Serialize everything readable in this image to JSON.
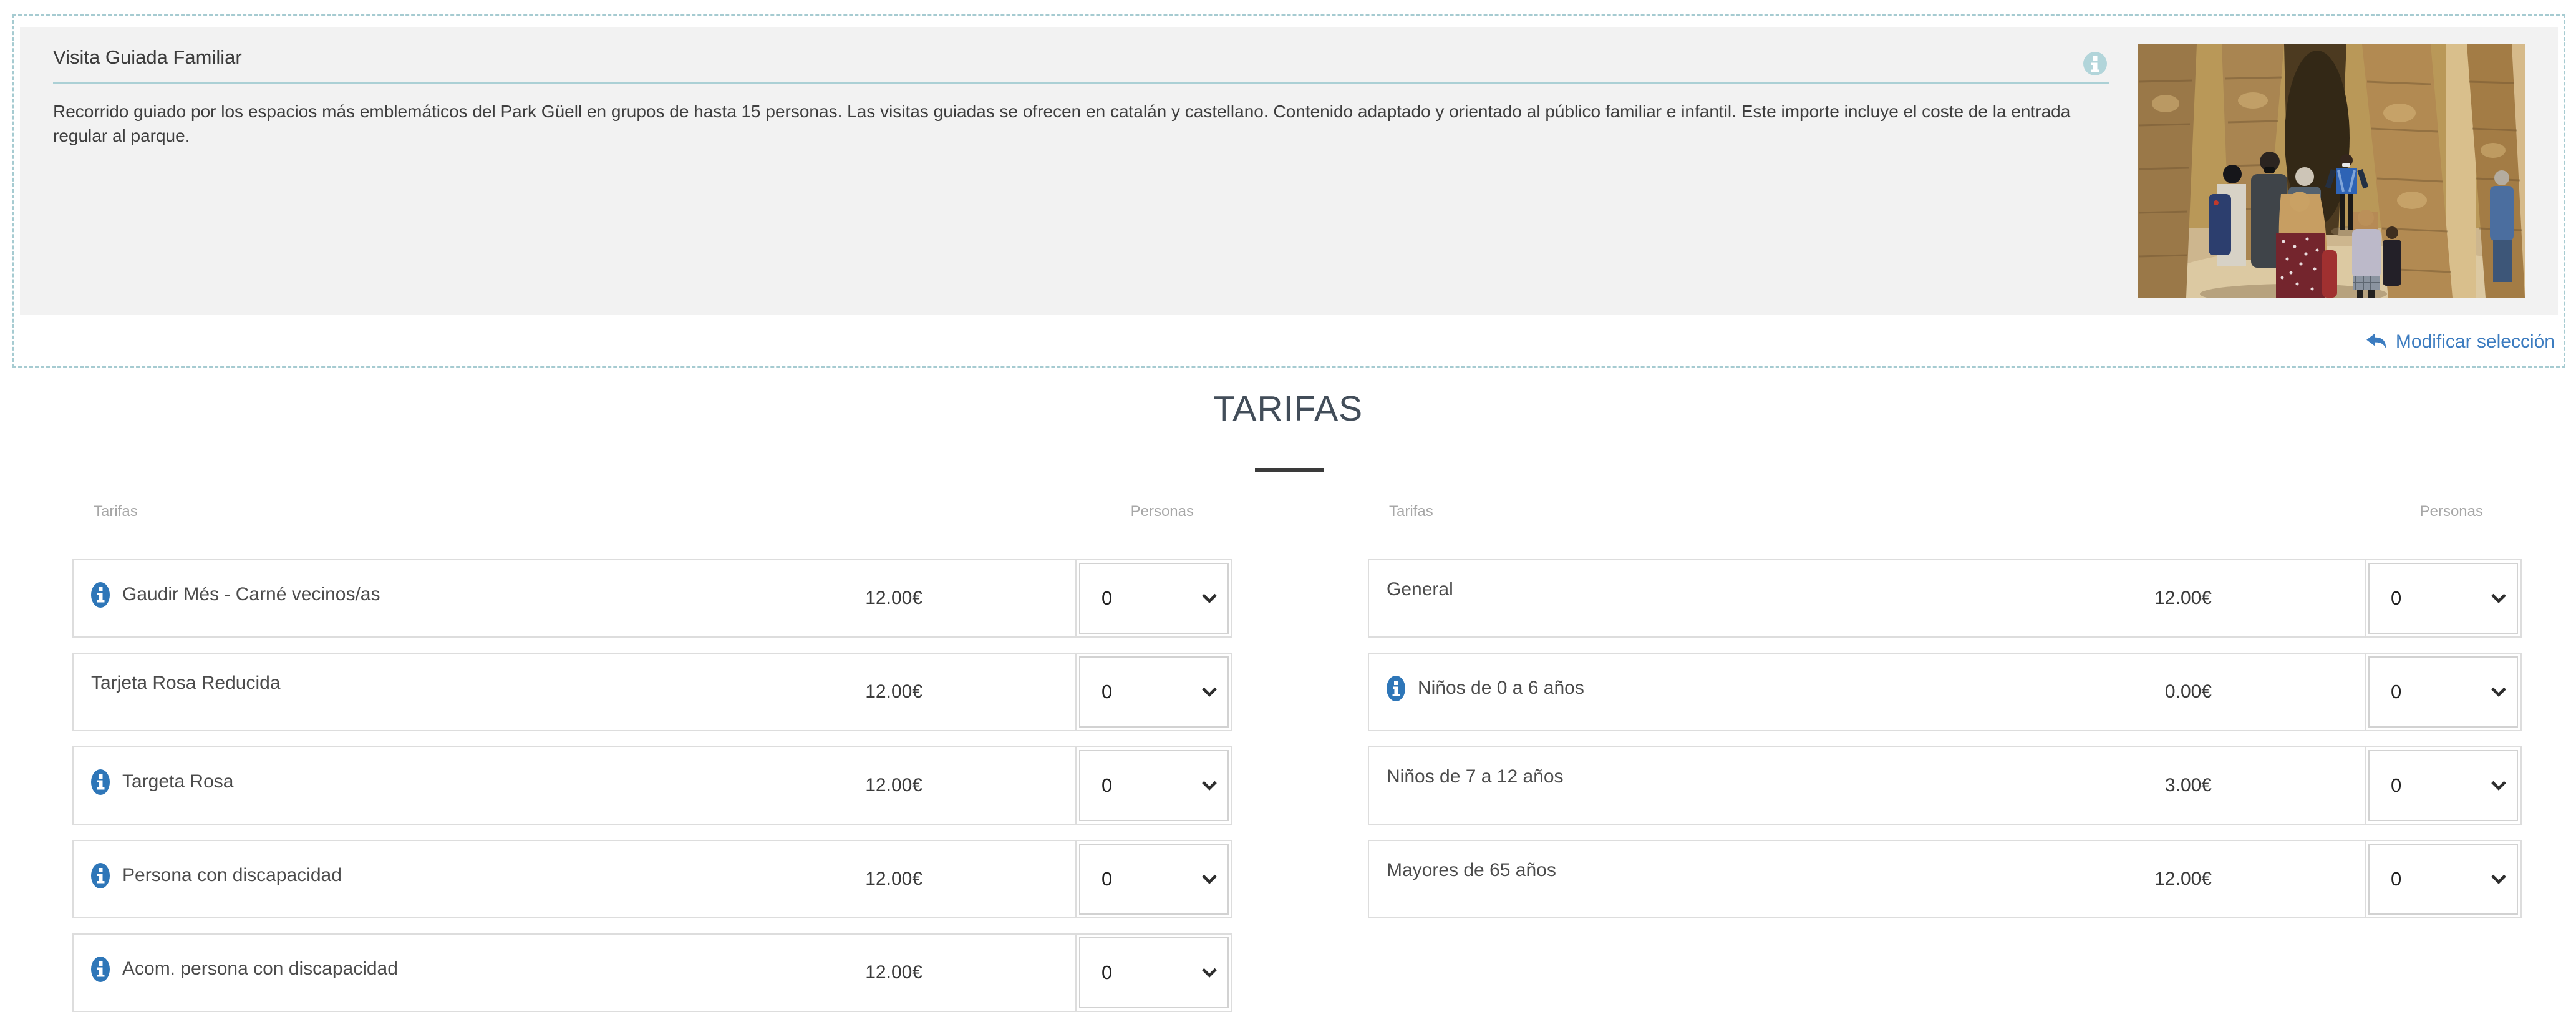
{
  "header": {
    "title": "Visita Guiada Familiar",
    "description": "Recorrido guiado por los espacios más emblemáticos del Park Güell en grupos de hasta 15 personas. Las visitas guiadas se ofrecen en catalán y castellano. Contenido adaptado y orientado al público familiar e infantil. Este importe incluye el coste de la entrada regular al parque.",
    "info_icon": "info-circle",
    "modify_label": "Modificar selección"
  },
  "tarifas": {
    "heading": "TARIFAS",
    "column_headers": {
      "tariff": "Tarifas",
      "persons": "Personas"
    },
    "tables": [
      {
        "rows": [
          {
            "label": "Gaudir Més - Carné vecinos/as",
            "price": "12.00€",
            "qty": "0",
            "has_info": true
          },
          {
            "label": "Tarjeta Rosa Reducida",
            "price": "12.00€",
            "qty": "0",
            "has_info": false
          },
          {
            "label": "Targeta Rosa",
            "price": "12.00€",
            "qty": "0",
            "has_info": true
          },
          {
            "label": "Persona con discapacidad",
            "price": "12.00€",
            "qty": "0",
            "has_info": true
          },
          {
            "label": "Acom. persona con discapacidad",
            "price": "12.00€",
            "qty": "0",
            "has_info": true
          }
        ]
      },
      {
        "rows": [
          {
            "label": "General",
            "price": "12.00€",
            "qty": "0",
            "has_info": false
          },
          {
            "label": "Niños de 0 a 6 años",
            "price": "0.00€",
            "qty": "0",
            "has_info": true
          },
          {
            "label": "Niños de 7 a 12 años",
            "price": "3.00€",
            "qty": "0",
            "has_info": false
          },
          {
            "label": "Mayores de 65 años",
            "price": "12.00€",
            "qty": "0",
            "has_info": false
          }
        ]
      }
    ]
  },
  "colors": {
    "accent_teal_dash": "#a6cbd1",
    "title_rule_teal": "#abd0d5",
    "panel_bg": "#f2f2f2",
    "info_blue": "#2e76b8",
    "header_info_teal": "#b2d5da",
    "link_blue": "#3c7cc0",
    "heading_slate": "#424d59",
    "heading_rule_dark": "#3a3a3a"
  }
}
